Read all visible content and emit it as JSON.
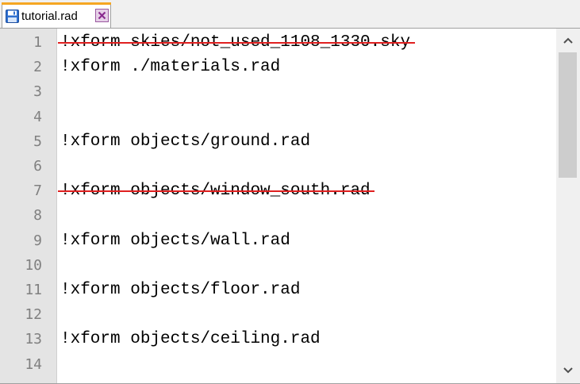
{
  "tab": {
    "label": "tutorial.rad",
    "active": true
  },
  "colors": {
    "tab_accent": "#f5a623",
    "strike": "#e02020",
    "gutter_bg": "#e4e4e4",
    "line_number": "#808080"
  },
  "editor": {
    "lines": [
      {
        "number": "1",
        "text": "!xform skies/not_used_1108_1330.sky",
        "struck": true
      },
      {
        "number": "2",
        "text": "!xform ./materials.rad",
        "struck": false
      },
      {
        "number": "3",
        "text": "",
        "struck": false
      },
      {
        "number": "4",
        "text": "",
        "struck": false
      },
      {
        "number": "5",
        "text": "!xform objects/ground.rad",
        "struck": false
      },
      {
        "number": "6",
        "text": "",
        "struck": false
      },
      {
        "number": "7",
        "text": "!xform objects/window_south.rad",
        "struck": true
      },
      {
        "number": "8",
        "text": "",
        "struck": false
      },
      {
        "number": "9",
        "text": "!xform objects/wall.rad",
        "struck": false
      },
      {
        "number": "10",
        "text": "",
        "struck": false
      },
      {
        "number": "11",
        "text": "!xform objects/floor.rad",
        "struck": false
      },
      {
        "number": "12",
        "text": "",
        "struck": false
      },
      {
        "number": "13",
        "text": "!xform objects/ceiling.rad",
        "struck": false
      },
      {
        "number": "14",
        "text": "",
        "struck": false
      }
    ]
  },
  "scrollbar": {
    "up_icon": "chevron-up-icon",
    "down_icon": "chevron-down-icon"
  }
}
